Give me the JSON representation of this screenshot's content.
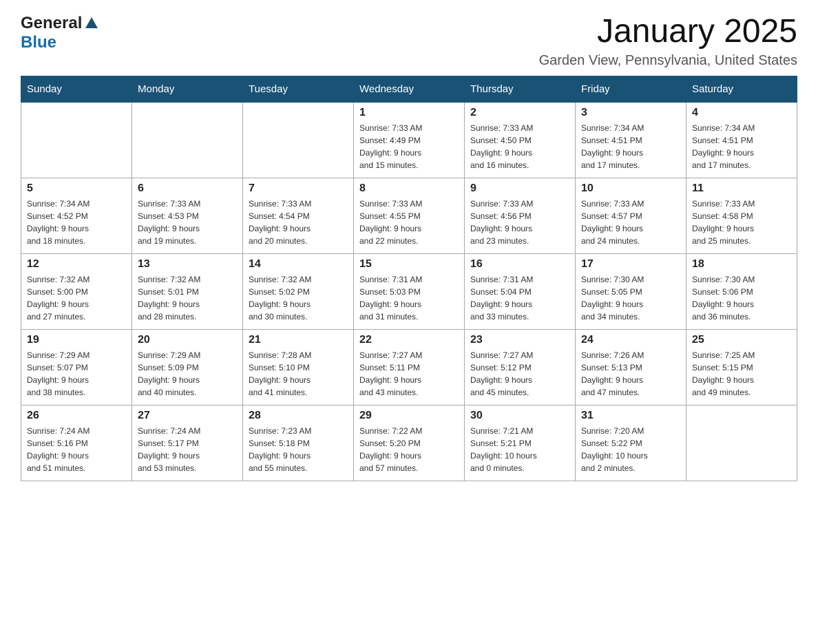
{
  "header": {
    "month_title": "January 2025",
    "location": "Garden View, Pennsylvania, United States",
    "logo_general": "General",
    "logo_blue": "Blue"
  },
  "days_of_week": [
    "Sunday",
    "Monday",
    "Tuesday",
    "Wednesday",
    "Thursday",
    "Friday",
    "Saturday"
  ],
  "weeks": [
    [
      {
        "day": "",
        "info": ""
      },
      {
        "day": "",
        "info": ""
      },
      {
        "day": "",
        "info": ""
      },
      {
        "day": "1",
        "info": "Sunrise: 7:33 AM\nSunset: 4:49 PM\nDaylight: 9 hours\nand 15 minutes."
      },
      {
        "day": "2",
        "info": "Sunrise: 7:33 AM\nSunset: 4:50 PM\nDaylight: 9 hours\nand 16 minutes."
      },
      {
        "day": "3",
        "info": "Sunrise: 7:34 AM\nSunset: 4:51 PM\nDaylight: 9 hours\nand 17 minutes."
      },
      {
        "day": "4",
        "info": "Sunrise: 7:34 AM\nSunset: 4:51 PM\nDaylight: 9 hours\nand 17 minutes."
      }
    ],
    [
      {
        "day": "5",
        "info": "Sunrise: 7:34 AM\nSunset: 4:52 PM\nDaylight: 9 hours\nand 18 minutes."
      },
      {
        "day": "6",
        "info": "Sunrise: 7:33 AM\nSunset: 4:53 PM\nDaylight: 9 hours\nand 19 minutes."
      },
      {
        "day": "7",
        "info": "Sunrise: 7:33 AM\nSunset: 4:54 PM\nDaylight: 9 hours\nand 20 minutes."
      },
      {
        "day": "8",
        "info": "Sunrise: 7:33 AM\nSunset: 4:55 PM\nDaylight: 9 hours\nand 22 minutes."
      },
      {
        "day": "9",
        "info": "Sunrise: 7:33 AM\nSunset: 4:56 PM\nDaylight: 9 hours\nand 23 minutes."
      },
      {
        "day": "10",
        "info": "Sunrise: 7:33 AM\nSunset: 4:57 PM\nDaylight: 9 hours\nand 24 minutes."
      },
      {
        "day": "11",
        "info": "Sunrise: 7:33 AM\nSunset: 4:58 PM\nDaylight: 9 hours\nand 25 minutes."
      }
    ],
    [
      {
        "day": "12",
        "info": "Sunrise: 7:32 AM\nSunset: 5:00 PM\nDaylight: 9 hours\nand 27 minutes."
      },
      {
        "day": "13",
        "info": "Sunrise: 7:32 AM\nSunset: 5:01 PM\nDaylight: 9 hours\nand 28 minutes."
      },
      {
        "day": "14",
        "info": "Sunrise: 7:32 AM\nSunset: 5:02 PM\nDaylight: 9 hours\nand 30 minutes."
      },
      {
        "day": "15",
        "info": "Sunrise: 7:31 AM\nSunset: 5:03 PM\nDaylight: 9 hours\nand 31 minutes."
      },
      {
        "day": "16",
        "info": "Sunrise: 7:31 AM\nSunset: 5:04 PM\nDaylight: 9 hours\nand 33 minutes."
      },
      {
        "day": "17",
        "info": "Sunrise: 7:30 AM\nSunset: 5:05 PM\nDaylight: 9 hours\nand 34 minutes."
      },
      {
        "day": "18",
        "info": "Sunrise: 7:30 AM\nSunset: 5:06 PM\nDaylight: 9 hours\nand 36 minutes."
      }
    ],
    [
      {
        "day": "19",
        "info": "Sunrise: 7:29 AM\nSunset: 5:07 PM\nDaylight: 9 hours\nand 38 minutes."
      },
      {
        "day": "20",
        "info": "Sunrise: 7:29 AM\nSunset: 5:09 PM\nDaylight: 9 hours\nand 40 minutes."
      },
      {
        "day": "21",
        "info": "Sunrise: 7:28 AM\nSunset: 5:10 PM\nDaylight: 9 hours\nand 41 minutes."
      },
      {
        "day": "22",
        "info": "Sunrise: 7:27 AM\nSunset: 5:11 PM\nDaylight: 9 hours\nand 43 minutes."
      },
      {
        "day": "23",
        "info": "Sunrise: 7:27 AM\nSunset: 5:12 PM\nDaylight: 9 hours\nand 45 minutes."
      },
      {
        "day": "24",
        "info": "Sunrise: 7:26 AM\nSunset: 5:13 PM\nDaylight: 9 hours\nand 47 minutes."
      },
      {
        "day": "25",
        "info": "Sunrise: 7:25 AM\nSunset: 5:15 PM\nDaylight: 9 hours\nand 49 minutes."
      }
    ],
    [
      {
        "day": "26",
        "info": "Sunrise: 7:24 AM\nSunset: 5:16 PM\nDaylight: 9 hours\nand 51 minutes."
      },
      {
        "day": "27",
        "info": "Sunrise: 7:24 AM\nSunset: 5:17 PM\nDaylight: 9 hours\nand 53 minutes."
      },
      {
        "day": "28",
        "info": "Sunrise: 7:23 AM\nSunset: 5:18 PM\nDaylight: 9 hours\nand 55 minutes."
      },
      {
        "day": "29",
        "info": "Sunrise: 7:22 AM\nSunset: 5:20 PM\nDaylight: 9 hours\nand 57 minutes."
      },
      {
        "day": "30",
        "info": "Sunrise: 7:21 AM\nSunset: 5:21 PM\nDaylight: 10 hours\nand 0 minutes."
      },
      {
        "day": "31",
        "info": "Sunrise: 7:20 AM\nSunset: 5:22 PM\nDaylight: 10 hours\nand 2 minutes."
      },
      {
        "day": "",
        "info": ""
      }
    ]
  ]
}
